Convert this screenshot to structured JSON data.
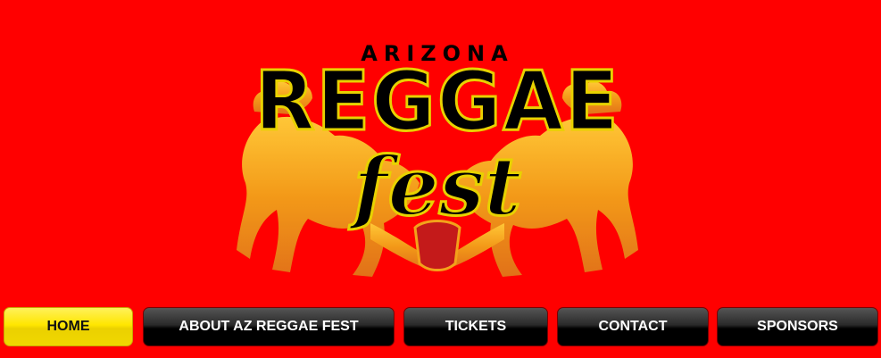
{
  "logo": {
    "top_text": "ARIZONA",
    "main_text": "REGGAE",
    "script_text": "fest"
  },
  "nav": {
    "items": [
      {
        "label": "HOME",
        "active": true
      },
      {
        "label": "ABOUT AZ REGGAE FEST",
        "active": false
      },
      {
        "label": "TICKETS",
        "active": false
      },
      {
        "label": "CONTACT",
        "active": false
      },
      {
        "label": "SPONSORS",
        "active": false
      }
    ]
  },
  "colors": {
    "background": "#ff0000",
    "active_nav": "#ffe600",
    "nav": "#000000",
    "lion_gold": "#f5a623"
  }
}
